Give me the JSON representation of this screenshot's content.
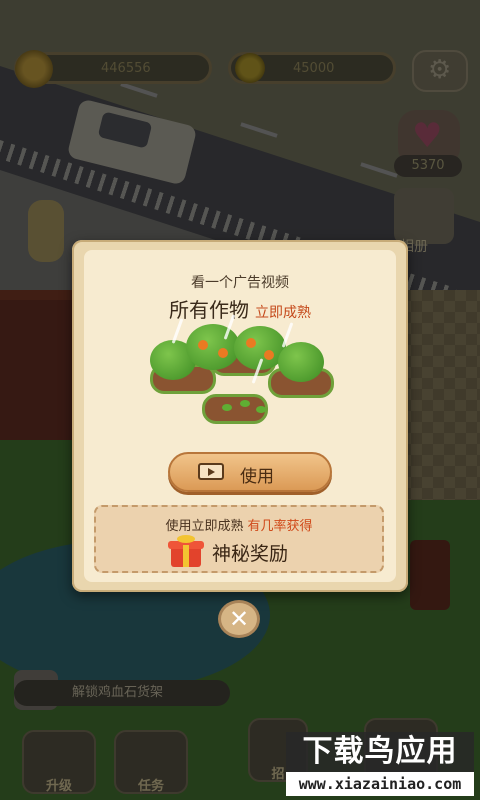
{
  "hud": {
    "coins": "446556",
    "apples": "45000",
    "hearts": "5370",
    "album_label": "相册"
  },
  "dialog": {
    "subtitle": "看一个广告视频",
    "title": "所有作物",
    "title_highlight": "立即成熟",
    "use_button": "使用",
    "reward_line_a": "使用立即成熟",
    "reward_line_b": "有几率获得",
    "reward_title": "神秘奖励",
    "close_symbol": "✕"
  },
  "bottom": {
    "task_text": "解锁鸡血石货架",
    "upgrade_label": "升级",
    "tasks_label": "任务",
    "recruit_label": "招",
    "other_label": ""
  },
  "watermark": {
    "top": "下载鸟应用",
    "bottom": "www.xiazainiao.com"
  },
  "icons": {
    "coin": "coin-icon",
    "apple": "apple-icon",
    "settings": "gear-icon",
    "heart": "heart-icon",
    "video": "play-video-icon",
    "gift": "gift-icon",
    "close": "close-icon"
  }
}
